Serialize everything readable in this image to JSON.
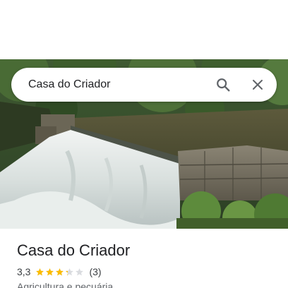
{
  "search": {
    "query": "Casa do Criador"
  },
  "icons": {
    "search": "search-icon",
    "close": "close-icon",
    "star": "star-icon"
  },
  "place": {
    "name": "Casa do Criador",
    "rating_text": "3,3",
    "rating_value": 3.3,
    "reviews_text": "(3)",
    "category": "Agricultura e pecuária"
  },
  "colors": {
    "star_filled": "#fbbc04",
    "star_empty": "#dadce0",
    "icon_gray": "#5f6368",
    "text_primary": "#202124"
  }
}
